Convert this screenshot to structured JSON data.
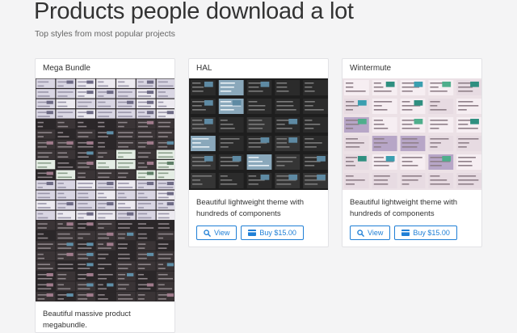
{
  "page": {
    "title": "Products people download a lot",
    "subtitle": "Top styles from most popular projects"
  },
  "products": [
    {
      "name": "Mega Bundle",
      "description": "Beautiful massive product megabundle.",
      "theme": "mixed-dark"
    },
    {
      "name": "HAL",
      "description": "Beautiful lightweight theme with hundreds of components",
      "view_label": "View",
      "buy_label": "Buy $15.00",
      "theme": "dark"
    },
    {
      "name": "Wintermute",
      "description": "Beautiful lightweight theme with hundreds of components",
      "view_label": "View",
      "buy_label": "Buy $15.00",
      "theme": "pink"
    }
  ],
  "icons": {
    "view": "search-icon",
    "buy": "credit-card-icon"
  },
  "colors": {
    "accent": "#1f7fd6",
    "dark_thumb_bg": "#1e1e1e",
    "pink_thumb_bg": "#ece1e6"
  }
}
